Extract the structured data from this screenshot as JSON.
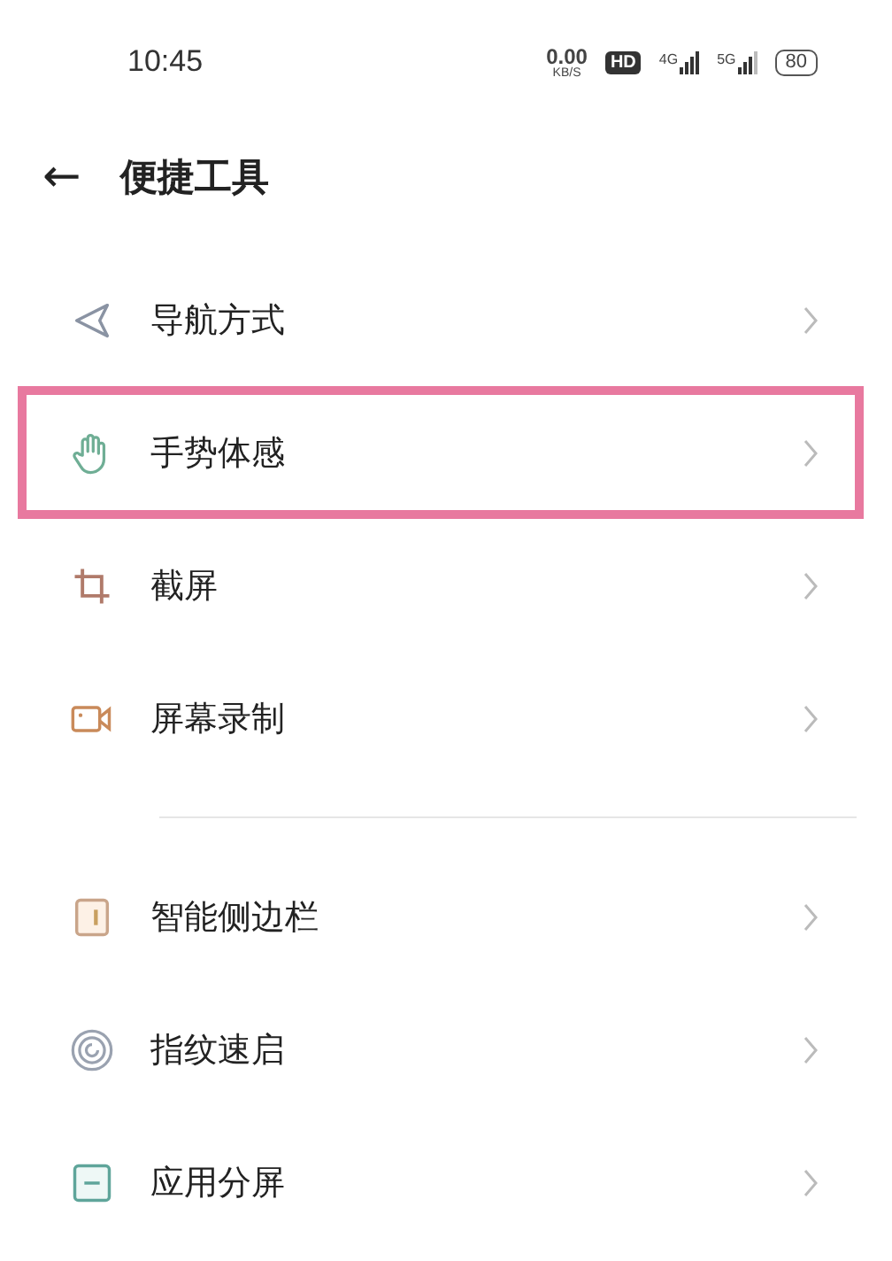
{
  "status_bar": {
    "time": "10:45",
    "speed": "0.00",
    "speed_unit": "KB/S",
    "hd": "HD",
    "net_1": "4G",
    "net_2": "5G",
    "battery": "80"
  },
  "header": {
    "back": "←",
    "title": "便捷工具"
  },
  "groups": [
    {
      "items": [
        {
          "kind": "navigation",
          "label": "导航方式",
          "highlighted": false
        },
        {
          "kind": "gesture",
          "label": "手势体感",
          "highlighted": true
        },
        {
          "kind": "screenshot",
          "label": "截屏",
          "highlighted": false
        },
        {
          "kind": "record",
          "label": "屏幕录制",
          "highlighted": false
        }
      ]
    },
    {
      "items": [
        {
          "kind": "sidebar",
          "label": "智能侧边栏",
          "highlighted": false
        },
        {
          "kind": "fingerprint",
          "label": "指纹速启",
          "highlighted": false
        },
        {
          "kind": "split",
          "label": "应用分屏",
          "highlighted": false
        }
      ]
    }
  ]
}
